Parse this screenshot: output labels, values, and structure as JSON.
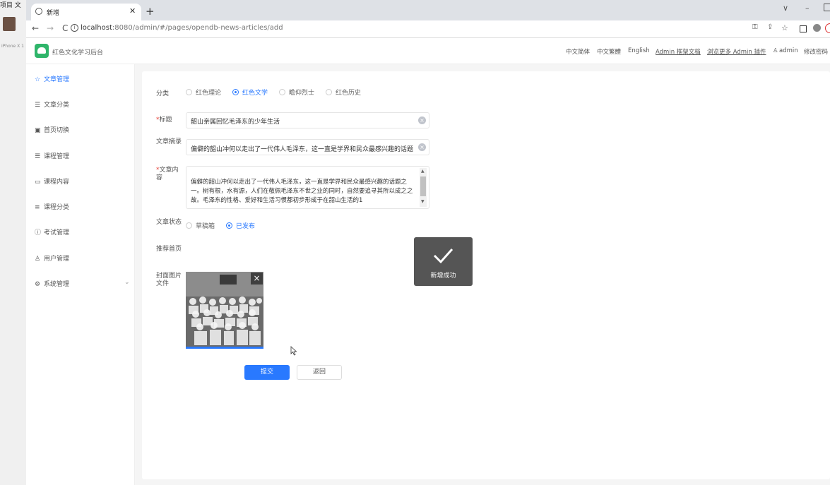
{
  "outer_app": {
    "menu": "项目  文",
    "device": "iPhone X 1"
  },
  "browser": {
    "tab_title": "新增",
    "url_host": "localhost",
    "url_rest": ":8080/admin/#/pages/opendb-news-articles/add",
    "win_min": "–",
    "win_chev": "∨"
  },
  "header": {
    "title": "红色文化学习后台",
    "links": [
      "中文简体",
      "中文繁體",
      "English",
      "Admin 框架文档",
      "浏览更多 Admin 插件",
      "admin",
      "修改密码"
    ]
  },
  "sidebar": {
    "items": [
      {
        "label": "文章管理",
        "icon": "star-icon"
      },
      {
        "label": "文章分类",
        "icon": "list-icon"
      },
      {
        "label": "首页切换",
        "icon": "image-icon"
      },
      {
        "label": "课程管理",
        "icon": "list-icon"
      },
      {
        "label": "课程内容",
        "icon": "folder-icon"
      },
      {
        "label": "课程分类",
        "icon": "menu-icon"
      },
      {
        "label": "考试管理",
        "icon": "info-icon"
      },
      {
        "label": "用户管理",
        "icon": "user-icon"
      },
      {
        "label": "系统管理",
        "icon": "gear-icon"
      }
    ]
  },
  "form": {
    "category_label": "分类",
    "categories": [
      {
        "label": "红色理论",
        "selected": false
      },
      {
        "label": "红色文学",
        "selected": true
      },
      {
        "label": "瞻仰烈士",
        "selected": false
      },
      {
        "label": "红色历史",
        "selected": false
      }
    ],
    "title_label": "标题",
    "title_value": "韶山亲属回忆毛泽东的少年生活",
    "summary_label": "文章摘录",
    "summary_value": "偏僻的韶山冲何以走出了一代伟人毛泽东，这一直是学界和民众最感兴趣的话题",
    "content_label": "文章内容",
    "content_value": "偏僻的韶山冲何以走出了一代伟人毛泽东，这一直是学界和民众最感兴趣的话题之一。树有根，水有源，人们在敬佩毛泽东不世之业的同时，自然要追寻其所以成之之故。毛泽东的性格、爱好和生活习惯都初步形成于在韶山生活的1",
    "status_label": "文章状态",
    "statuses": [
      {
        "label": "草稿箱",
        "selected": false
      },
      {
        "label": "已发布",
        "selected": true
      }
    ],
    "recommend_label": "推荐首页",
    "cover_label": "封面图片文件",
    "submit_label": "提交",
    "back_label": "返回"
  },
  "toast": {
    "text": "新增成功"
  }
}
